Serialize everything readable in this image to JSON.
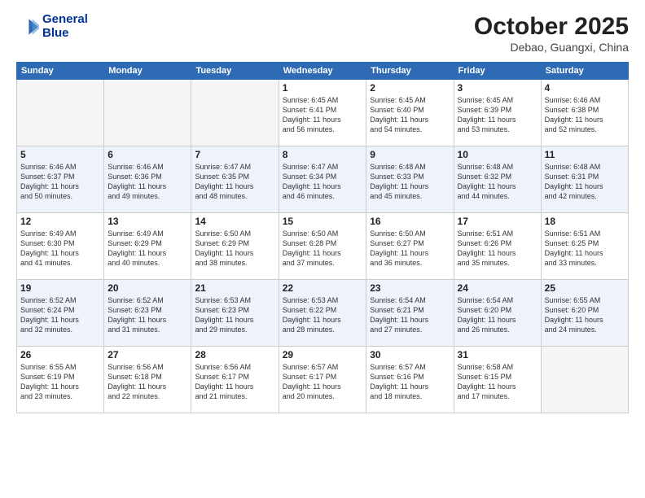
{
  "header": {
    "logo_line1": "General",
    "logo_line2": "Blue",
    "month": "October 2025",
    "location": "Debao, Guangxi, China"
  },
  "weekdays": [
    "Sunday",
    "Monday",
    "Tuesday",
    "Wednesday",
    "Thursday",
    "Friday",
    "Saturday"
  ],
  "weeks": [
    [
      {
        "day": "",
        "info": ""
      },
      {
        "day": "",
        "info": ""
      },
      {
        "day": "",
        "info": ""
      },
      {
        "day": "1",
        "info": "Sunrise: 6:45 AM\nSunset: 6:41 PM\nDaylight: 11 hours\nand 56 minutes."
      },
      {
        "day": "2",
        "info": "Sunrise: 6:45 AM\nSunset: 6:40 PM\nDaylight: 11 hours\nand 54 minutes."
      },
      {
        "day": "3",
        "info": "Sunrise: 6:45 AM\nSunset: 6:39 PM\nDaylight: 11 hours\nand 53 minutes."
      },
      {
        "day": "4",
        "info": "Sunrise: 6:46 AM\nSunset: 6:38 PM\nDaylight: 11 hours\nand 52 minutes."
      }
    ],
    [
      {
        "day": "5",
        "info": "Sunrise: 6:46 AM\nSunset: 6:37 PM\nDaylight: 11 hours\nand 50 minutes."
      },
      {
        "day": "6",
        "info": "Sunrise: 6:46 AM\nSunset: 6:36 PM\nDaylight: 11 hours\nand 49 minutes."
      },
      {
        "day": "7",
        "info": "Sunrise: 6:47 AM\nSunset: 6:35 PM\nDaylight: 11 hours\nand 48 minutes."
      },
      {
        "day": "8",
        "info": "Sunrise: 6:47 AM\nSunset: 6:34 PM\nDaylight: 11 hours\nand 46 minutes."
      },
      {
        "day": "9",
        "info": "Sunrise: 6:48 AM\nSunset: 6:33 PM\nDaylight: 11 hours\nand 45 minutes."
      },
      {
        "day": "10",
        "info": "Sunrise: 6:48 AM\nSunset: 6:32 PM\nDaylight: 11 hours\nand 44 minutes."
      },
      {
        "day": "11",
        "info": "Sunrise: 6:48 AM\nSunset: 6:31 PM\nDaylight: 11 hours\nand 42 minutes."
      }
    ],
    [
      {
        "day": "12",
        "info": "Sunrise: 6:49 AM\nSunset: 6:30 PM\nDaylight: 11 hours\nand 41 minutes."
      },
      {
        "day": "13",
        "info": "Sunrise: 6:49 AM\nSunset: 6:29 PM\nDaylight: 11 hours\nand 40 minutes."
      },
      {
        "day": "14",
        "info": "Sunrise: 6:50 AM\nSunset: 6:29 PM\nDaylight: 11 hours\nand 38 minutes."
      },
      {
        "day": "15",
        "info": "Sunrise: 6:50 AM\nSunset: 6:28 PM\nDaylight: 11 hours\nand 37 minutes."
      },
      {
        "day": "16",
        "info": "Sunrise: 6:50 AM\nSunset: 6:27 PM\nDaylight: 11 hours\nand 36 minutes."
      },
      {
        "day": "17",
        "info": "Sunrise: 6:51 AM\nSunset: 6:26 PM\nDaylight: 11 hours\nand 35 minutes."
      },
      {
        "day": "18",
        "info": "Sunrise: 6:51 AM\nSunset: 6:25 PM\nDaylight: 11 hours\nand 33 minutes."
      }
    ],
    [
      {
        "day": "19",
        "info": "Sunrise: 6:52 AM\nSunset: 6:24 PM\nDaylight: 11 hours\nand 32 minutes."
      },
      {
        "day": "20",
        "info": "Sunrise: 6:52 AM\nSunset: 6:23 PM\nDaylight: 11 hours\nand 31 minutes."
      },
      {
        "day": "21",
        "info": "Sunrise: 6:53 AM\nSunset: 6:23 PM\nDaylight: 11 hours\nand 29 minutes."
      },
      {
        "day": "22",
        "info": "Sunrise: 6:53 AM\nSunset: 6:22 PM\nDaylight: 11 hours\nand 28 minutes."
      },
      {
        "day": "23",
        "info": "Sunrise: 6:54 AM\nSunset: 6:21 PM\nDaylight: 11 hours\nand 27 minutes."
      },
      {
        "day": "24",
        "info": "Sunrise: 6:54 AM\nSunset: 6:20 PM\nDaylight: 11 hours\nand 26 minutes."
      },
      {
        "day": "25",
        "info": "Sunrise: 6:55 AM\nSunset: 6:20 PM\nDaylight: 11 hours\nand 24 minutes."
      }
    ],
    [
      {
        "day": "26",
        "info": "Sunrise: 6:55 AM\nSunset: 6:19 PM\nDaylight: 11 hours\nand 23 minutes."
      },
      {
        "day": "27",
        "info": "Sunrise: 6:56 AM\nSunset: 6:18 PM\nDaylight: 11 hours\nand 22 minutes."
      },
      {
        "day": "28",
        "info": "Sunrise: 6:56 AM\nSunset: 6:17 PM\nDaylight: 11 hours\nand 21 minutes."
      },
      {
        "day": "29",
        "info": "Sunrise: 6:57 AM\nSunset: 6:17 PM\nDaylight: 11 hours\nand 20 minutes."
      },
      {
        "day": "30",
        "info": "Sunrise: 6:57 AM\nSunset: 6:16 PM\nDaylight: 11 hours\nand 18 minutes."
      },
      {
        "day": "31",
        "info": "Sunrise: 6:58 AM\nSunset: 6:15 PM\nDaylight: 11 hours\nand 17 minutes."
      },
      {
        "day": "",
        "info": ""
      }
    ]
  ]
}
